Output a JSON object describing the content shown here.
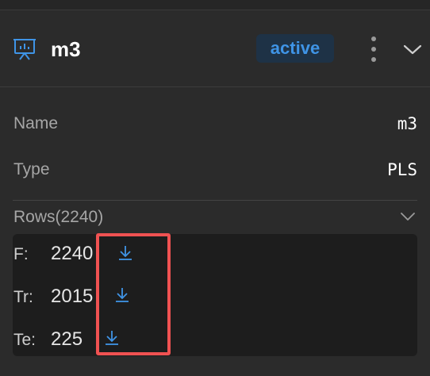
{
  "model": {
    "title": "m3",
    "status": "active"
  },
  "properties": [
    {
      "label": "Name",
      "value": "m3"
    },
    {
      "label": "Type",
      "value": "PLS"
    }
  ],
  "rows": {
    "heading": "Rows(2240)",
    "splits": [
      {
        "key": "F:",
        "value": "2240"
      },
      {
        "key": "Tr:",
        "value": "2015"
      },
      {
        "key": "Te:",
        "value": "225"
      }
    ]
  },
  "colors": {
    "accent": "#3f94e6",
    "highlight": "#f05252",
    "panel": "#1d1d1d"
  },
  "icons": {
    "model": "presentation-chart-icon",
    "menu": "kebab-menu-icon",
    "collapse": "chevron-down-icon",
    "download": "download-icon"
  }
}
